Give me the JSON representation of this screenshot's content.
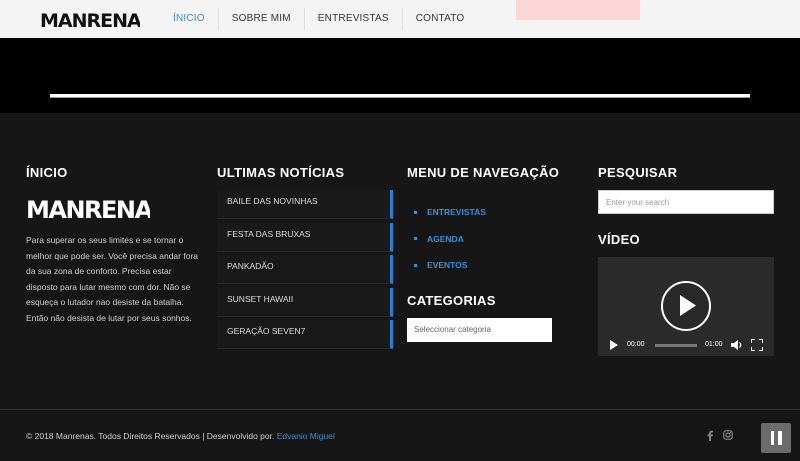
{
  "header": {
    "logo_text": "MANRENAS",
    "nav": [
      {
        "label": "ÍNICIO",
        "active": true
      },
      {
        "label": "SOBRE MIM",
        "active": false
      },
      {
        "label": "ENTREVISTAS",
        "active": false
      },
      {
        "label": "CONTATO",
        "active": false
      }
    ]
  },
  "footer": {
    "col1": {
      "title": "ÍNICIO",
      "logo_text": "MANRENAS",
      "text": "Para superar os seus limites e se tornar o melhor que pode ser. Você precisa andar fora da sua zona de conforto. Precisa estar disposto para lutar mesmo com dor. Não se esqueça o lutador nao desiste da batalha. Então não desista de lutar por seus sonhos."
    },
    "col2": {
      "title": "ULTIMAS NOTÍCIAS",
      "items": [
        "BAILE DAS NOVINHAS",
        "FESTA DAS BRUXAS",
        "PANKADÃO",
        "SUNSET HAWAII",
        "GERAÇÃO SEVEN7"
      ]
    },
    "col3": {
      "title": "MENU DE NAVEGAÇÃO",
      "items": [
        "ENTREVISTAS",
        "AGENDA",
        "EVENTOS"
      ],
      "categories_title": "CATEGORIAS",
      "categories_select": "Seleccionar categoria"
    },
    "col4": {
      "title": "PESQUISAR",
      "search_placeholder": "Enter your search",
      "video_title": "VÍDEO",
      "video": {
        "current_time": "00:00",
        "duration": "01:00"
      }
    }
  },
  "bottom": {
    "copyright": "© 2018 Manrenas. Todos Direitos Reservados | Desenvolvido por.",
    "developer": "Edvanio Miguel",
    "social": [
      "facebook-icon",
      "instagram-icon"
    ]
  },
  "colors": {
    "accent": "#3a8fd6",
    "footer_bg": "#161616"
  }
}
